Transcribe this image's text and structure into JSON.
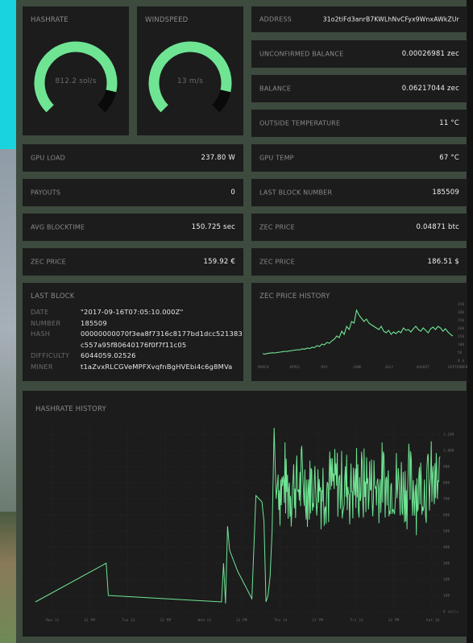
{
  "theme": {
    "accent": "#6fe594",
    "tile_bg": "#1c1c1c",
    "track": "#0a0a0a"
  },
  "hashrate": {
    "title": "HASHRATE",
    "value": "812.2 sol/s",
    "fraction": 0.88
  },
  "windspeed": {
    "title": "WINDSPEED",
    "value": "13 m/s",
    "fraction": 0.88
  },
  "right_stats": [
    {
      "label": "ADDRESS",
      "value": "31o2tiFd3anrB7KWLhNvCFyx9WnxAWkZUr"
    },
    {
      "label": "UNCONFIRMED BALANCE",
      "value": "0.00026981 zec"
    },
    {
      "label": "BALANCE",
      "value": "0.06217044 zec"
    },
    {
      "label": "OUTSIDE TEMPERATURE",
      "value": "11 °C"
    }
  ],
  "grid_stats": [
    {
      "label": "GPU LOAD",
      "value": "237.80 W"
    },
    {
      "label": "GPU TEMP",
      "value": "67 °C"
    },
    {
      "label": "PAYOUTS",
      "value": "0"
    },
    {
      "label": "LAST BLOCK NUMBER",
      "value": "185509"
    },
    {
      "label": "AVG BLOCKTIME",
      "value": "150.725 sec"
    },
    {
      "label": "ZEC PRICE",
      "value": "0.04871 btc"
    },
    {
      "label": "ZEC PRICE",
      "value": "159.92 €"
    },
    {
      "label": "ZEC PRICE",
      "value": "186.51 $"
    }
  ],
  "last_block": {
    "title": "LAST BLOCK",
    "rows": [
      {
        "key": "DATE",
        "value": "\"2017-09-16T07:05:10.000Z\""
      },
      {
        "key": "NUMBER",
        "value": "185509"
      },
      {
        "key": "HASH",
        "value": "00000000070f3ea8f7316c8177bd1dcc521383"
      },
      {
        "key": "",
        "value": "c557a95f80640176f0f7f11c05"
      },
      {
        "key": "DIFFICULTY",
        "value": "6044059.02526"
      },
      {
        "key": "MINER",
        "value": "t1aZvxRLCGVeMPFXvqfnBgHVEbi4c6g8MVa"
      }
    ]
  },
  "price_history": {
    "title": "ZEC PRICE HISTORY",
    "chart_data": {
      "type": "line",
      "x_ticks": [
        "MARCH",
        "APRIL",
        "MAY",
        "JUNE",
        "JULY",
        "AUGUST",
        "SEPTEMBER"
      ],
      "y_ticks": [
        "350",
        "300",
        "250",
        "200",
        "150",
        "100",
        "50",
        "0 $"
      ],
      "ylim": [
        0,
        350
      ],
      "values": [
        40,
        38,
        42,
        44,
        46,
        45,
        48,
        50,
        52,
        55,
        54,
        58,
        60,
        62,
        65,
        64,
        70,
        68,
        75,
        72,
        80,
        78,
        90,
        85,
        100,
        95,
        110,
        105,
        120,
        130,
        150,
        140,
        180,
        160,
        210,
        190,
        240,
        230,
        310,
        280,
        260,
        240,
        255,
        230,
        220,
        210,
        200,
        190,
        210,
        180,
        170,
        185,
        160,
        175,
        165,
        180,
        170,
        200,
        185,
        190,
        175,
        195,
        210,
        190,
        180,
        200,
        185,
        170,
        195,
        205,
        190,
        210,
        200,
        180,
        195,
        175,
        160,
        150
      ]
    }
  },
  "hashrate_history": {
    "title": "HASHRATE HISTORY",
    "chart_data": {
      "type": "line",
      "x_ticks": [
        "Mon 11",
        "12 PM",
        "Tue 12",
        "12 PM",
        "Wed 13",
        "12 PM",
        "Thu 14",
        "12 PM",
        "Fri 15",
        "12 PM",
        "Sat 16"
      ],
      "y_ticks": [
        "1,100",
        "1,000",
        "900",
        "800",
        "700",
        "600",
        "500",
        "400",
        "300",
        "200",
        "100",
        "0 sol/s"
      ],
      "ylim": [
        0,
        1150
      ],
      "segments": [
        [
          [
            0,
            60
          ],
          [
            0.175,
            300
          ],
          [
            0.18,
            100
          ],
          [
            0.46,
            60
          ],
          [
            0.465,
            300
          ],
          [
            0.47,
            50
          ],
          [
            0.475,
            530
          ],
          [
            0.48,
            380
          ],
          [
            0.5,
            250
          ],
          [
            0.535,
            80
          ],
          [
            0.545,
            720
          ],
          [
            0.56,
            680
          ],
          [
            0.565,
            560
          ],
          [
            0.57,
            60
          ],
          [
            0.575,
            100
          ],
          [
            0.58,
            220
          ],
          [
            0.585,
            500
          ],
          [
            0.59,
            1140
          ],
          [
            0.595,
            700
          ],
          [
            0.6,
            850
          ]
        ]
      ],
      "noise_start": 0.6,
      "noise_mean": 780,
      "noise_amp": 260
    }
  }
}
